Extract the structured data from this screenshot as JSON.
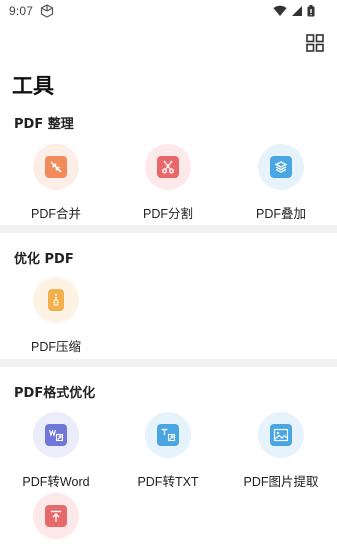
{
  "status": {
    "time": "9:07"
  },
  "header": {
    "title": "工具"
  },
  "sections": [
    {
      "title": "PDF 整理",
      "tools": [
        {
          "label": "PDF合并",
          "icon": "merge-icon"
        },
        {
          "label": "PDF分割",
          "icon": "scissors-icon"
        },
        {
          "label": "PDF叠加",
          "icon": "layers-icon"
        }
      ]
    },
    {
      "title": "优化 PDF",
      "tools": [
        {
          "label": "PDF压缩",
          "icon": "compress-icon"
        }
      ]
    },
    {
      "title": "PDF格式优化",
      "tools": [
        {
          "label": "PDF转Word",
          "icon": "word-icon"
        },
        {
          "label": "PDF转TXT",
          "icon": "txt-icon"
        },
        {
          "label": "PDF图片提取",
          "icon": "image-icon"
        },
        {
          "label": "",
          "icon": "upload-icon"
        }
      ]
    }
  ],
  "colors": {
    "orange": "#f28b5b",
    "red": "#e8696b",
    "blue": "#4aa6e3",
    "purple": "#6f78d8",
    "yellow": "#f2b04d",
    "divider": "#f2f2f2"
  }
}
